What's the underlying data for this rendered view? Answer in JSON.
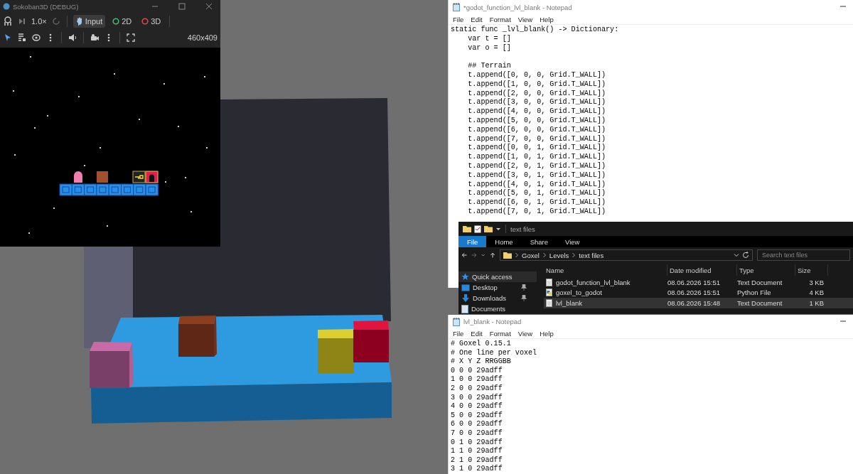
{
  "game_window": {
    "title": "Sokoban3D (DEBUG)",
    "speed": "1.0×",
    "modes": [
      {
        "label": "Input",
        "selected": true
      },
      {
        "label": "2D",
        "selected": false,
        "color": "#3fbf6a"
      },
      {
        "label": "3D",
        "selected": false,
        "color": "#e0474c"
      }
    ],
    "resolution": "460x409"
  },
  "code_notepad": {
    "title": "*godot_function_lvl_blank - Notepad",
    "menu": [
      "File",
      "Edit",
      "Format",
      "View",
      "Help"
    ],
    "header": [
      "static func _lvl_blank() -> Dictionary:",
      "    var t = []",
      "    var o = []"
    ],
    "sections": [
      {
        "comment": "    ## Terrain",
        "lines": [
          "    t.append([0, 0, 0, Grid.T_WALL])",
          "    t.append([1, 0, 0, Grid.T_WALL])",
          "    t.append([2, 0, 0, Grid.T_WALL])",
          "    t.append([3, 0, 0, Grid.T_WALL])",
          "    t.append([4, 0, 0, Grid.T_WALL])",
          "    t.append([5, 0, 0, Grid.T_WALL])",
          "    t.append([6, 0, 0, Grid.T_WALL])",
          "    t.append([7, 0, 0, Grid.T_WALL])",
          "    t.append([0, 0, 1, Grid.T_WALL])",
          "    t.append([1, 0, 1, Grid.T_WALL])",
          "    t.append([2, 0, 1, Grid.T_WALL])",
          "    t.append([3, 0, 1, Grid.T_WALL])",
          "    t.append([4, 0, 1, Grid.T_WALL])",
          "    t.append([5, 0, 1, Grid.T_WALL])",
          "    t.append([6, 0, 1, Grid.T_WALL])",
          "    t.append([7, 0, 1, Grid.T_WALL])"
        ]
      }
    ]
  },
  "explorer": {
    "title": "text files",
    "ribbon_tabs": [
      {
        "label": "File",
        "selected": true
      },
      {
        "label": "Home",
        "selected": false
      },
      {
        "label": "Share",
        "selected": false
      },
      {
        "label": "View",
        "selected": false
      }
    ],
    "breadcrumb": [
      "Goxel",
      "Levels",
      "text files"
    ],
    "search": {
      "placeholder": "Search text files"
    },
    "sidebar": [
      {
        "label": "Quick access",
        "kind": "star",
        "pinned": false,
        "selected": true
      },
      {
        "label": "Desktop",
        "kind": "desktop",
        "pinned": true,
        "selected": false
      },
      {
        "label": "Downloads",
        "kind": "downloads",
        "pinned": true,
        "selected": false
      },
      {
        "label": "Documents",
        "kind": "documents",
        "pinned": false,
        "selected": false
      }
    ],
    "columns": [
      "Name",
      "Date modified",
      "Type",
      "Size"
    ],
    "files": [
      {
        "name": "godot_function_lvl_blank",
        "modified": "08.06.2026 15:51",
        "type": "Text Document",
        "size": "3 KB",
        "kind": "text",
        "selected": false
      },
      {
        "name": "goxel_to_godot",
        "modified": "08.06.2026 15:51",
        "type": "Python File",
        "size": "4 KB",
        "kind": "python",
        "selected": false
      },
      {
        "name": "lvl_blank",
        "modified": "08.06.2026 15:48",
        "type": "Text Document",
        "size": "1 KB",
        "kind": "text",
        "selected": true
      }
    ]
  },
  "voxel_notepad": {
    "title": "lvl_blank - Notepad",
    "menu": [
      "File",
      "Edit",
      "Format",
      "View",
      "Help"
    ],
    "lines": [
      "# Goxel 0.15.1",
      "# One line per voxel",
      "# X Y Z RRGGBB",
      "0 0 0 29adff",
      "1 0 0 29adff",
      "2 0 0 29adff",
      "3 0 0 29adff",
      "4 0 0 29adff",
      "5 0 0 29adff",
      "6 0 0 29adff",
      "7 0 0 29adff",
      "0 1 0 29adff",
      "1 1 0 29adff",
      "2 1 0 29adff",
      "3 1 0 29adff"
    ]
  }
}
